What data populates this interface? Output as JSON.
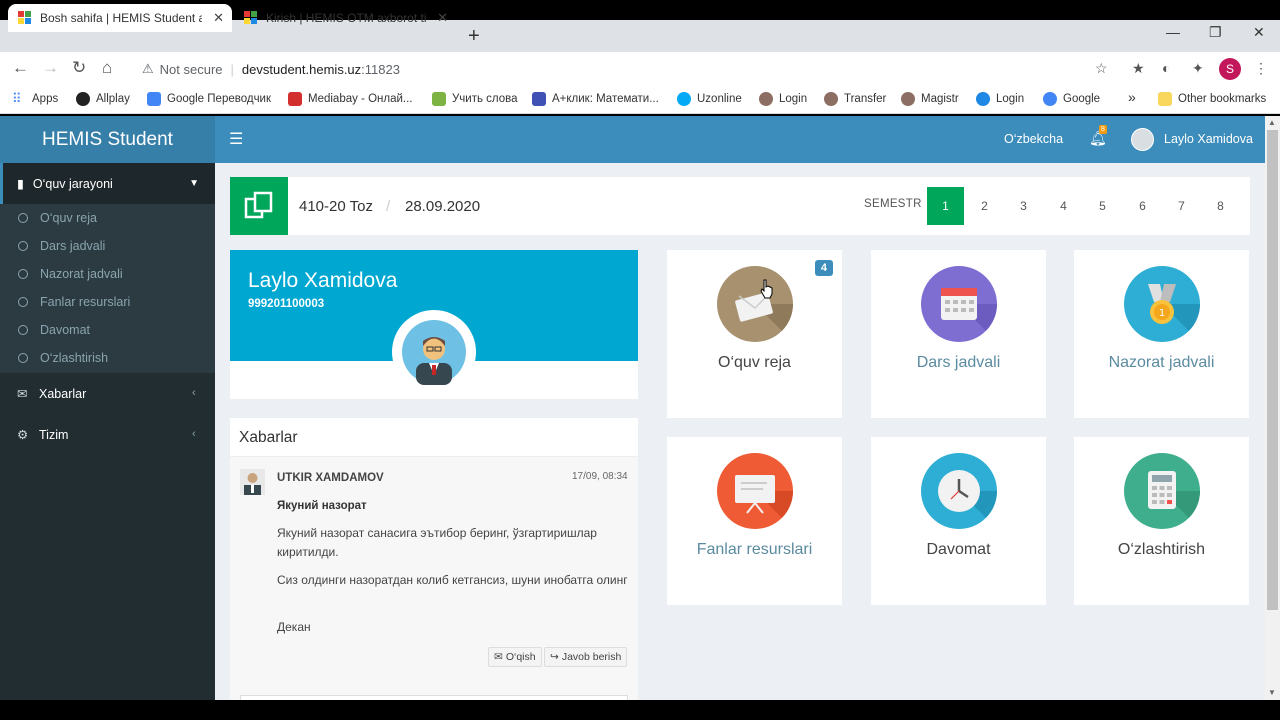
{
  "browser": {
    "tabs": [
      {
        "title": "Bosh sahifa | HEMIS Student axborot tizimi",
        "close": "✕"
      },
      {
        "title": "Kirish | HEMIS OTM axborot tizimi",
        "close": "✕"
      }
    ],
    "new_tab": "+",
    "window_controls": [
      "—",
      "❐",
      "✕"
    ],
    "security_label": "Not secure",
    "url_host": "devstudent.hemis.uz",
    "url_port": ":11823",
    "profile_initial": "S",
    "bookmarks": [
      {
        "label": "Apps",
        "color": "#4285f4"
      },
      {
        "label": "Allplay",
        "color": "#222222"
      },
      {
        "label": "Google Переводчик",
        "color": "#4285f4"
      },
      {
        "label": "Mediabay - Онлай...",
        "color": "#d32f2f"
      },
      {
        "label": "Учить слова",
        "color": "#7cb342"
      },
      {
        "label": "A+клик: Математи...",
        "color": "#3f51b5"
      },
      {
        "label": "Uzonline",
        "color": "#03a9f4"
      },
      {
        "label": "Login",
        "color": "#8d6e63"
      },
      {
        "label": "Transfer",
        "color": "#8d6e63"
      },
      {
        "label": "Magistr",
        "color": "#8d6e63"
      },
      {
        "label": "Login",
        "color": "#1e88e5"
      },
      {
        "label": "Google",
        "color": "#4285f4"
      }
    ],
    "bookmarks_more": "»",
    "other_bookmarks": "Other bookmarks"
  },
  "app": {
    "brand": "HEMIS Student",
    "language": "O‘zbekcha",
    "notification_count": "8",
    "user_name": "Laylo Xamidova"
  },
  "sidebar": {
    "section": "O‘quv jarayoni",
    "sub_items": [
      "O‘quv reja",
      "Dars jadvali",
      "Nazorat jadvali",
      "Fanlar resurslari",
      "Davomat",
      "O‘zlashtirish"
    ],
    "items": [
      {
        "label": "Xabarlar",
        "icon": "envelope-icon"
      },
      {
        "label": "Tizim",
        "icon": "gear-icon"
      }
    ]
  },
  "info_bar": {
    "group": "410-20 Toz",
    "date": "28.09.2020",
    "semester_label": "SEMESTR",
    "semesters": [
      "1",
      "2",
      "3",
      "4",
      "5",
      "6",
      "7",
      "8"
    ],
    "active_semester": "1"
  },
  "profile": {
    "name": "Laylo Xamidova",
    "id": "999201100003"
  },
  "news": {
    "title": "Xabarlar",
    "from": "UTKIR XAMDAMOV",
    "time": "17/09, 08:34",
    "subject": "Якуний назорат",
    "paragraphs": [
      "Якуний назорат санасига эътибор беринг, ўзгартиришлар киритилди.",
      "Сиз олдинги назоратдан колиб кетгансиз, шуни инобатга олинг",
      "Декан"
    ],
    "read_button": "O‘qish",
    "reply_button": "Javob berish"
  },
  "tiles": [
    {
      "label": "O‘quv reja",
      "color": "#a8916e",
      "icon": "book-icon",
      "badge": "4"
    },
    {
      "label": "Dars jadvali",
      "color": "#7f6ed2",
      "icon": "calendar-icon"
    },
    {
      "label": "Nazorat jadvali",
      "color": "#2eaed4",
      "icon": "medal-icon"
    },
    {
      "label": "Fanlar resurslari",
      "color": "#ef5b34",
      "icon": "presentation-icon"
    },
    {
      "label": "Davomat",
      "color": "#2eaed4",
      "icon": "clock-icon"
    },
    {
      "label": "O‘zlashtirish",
      "color": "#3fae8c",
      "icon": "calculator-icon"
    }
  ]
}
